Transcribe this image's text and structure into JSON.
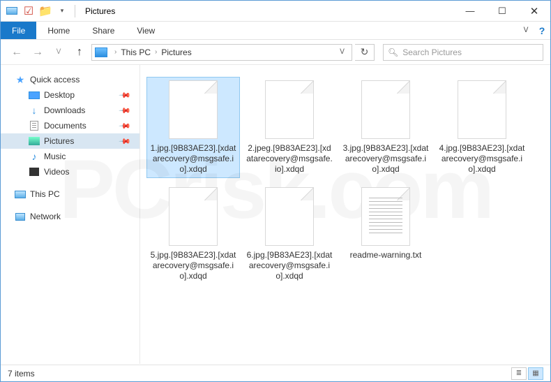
{
  "titlebar": {
    "app_title": "Pictures"
  },
  "window_controls": {
    "min": "—",
    "max": "☐",
    "close": "✕"
  },
  "ribbon": {
    "file_label": "File",
    "tabs": [
      "Home",
      "Share",
      "View"
    ],
    "chevron": "ᐯ",
    "help": "?"
  },
  "nav": {
    "back": "←",
    "forward": "→",
    "recent": "ᐯ",
    "up": "↑",
    "breadcrumb": [
      "This PC",
      "Pictures"
    ],
    "sep": "›",
    "drop": "ᐯ",
    "refresh": "↻",
    "search_placeholder": "Search Pictures",
    "search_icon": "🔍︎"
  },
  "sidebar": {
    "quick_access": "Quick access",
    "items": [
      {
        "label": "Desktop",
        "pinned": true
      },
      {
        "label": "Downloads",
        "pinned": true
      },
      {
        "label": "Documents",
        "pinned": true
      },
      {
        "label": "Pictures",
        "pinned": true,
        "selected": true
      },
      {
        "label": "Music",
        "pinned": false
      },
      {
        "label": "Videos",
        "pinned": false
      }
    ],
    "this_pc": "This PC",
    "network": "Network"
  },
  "files": [
    {
      "name": "1.jpg.[9B83AE23].[xdatarecovery@msgsafe.io].xdqd",
      "kind": "blank",
      "selected": true
    },
    {
      "name": "2.jpeg.[9B83AE23].[xdatarecovery@msgsafe.io].xdqd",
      "kind": "blank"
    },
    {
      "name": "3.jpg.[9B83AE23].[xdatarecovery@msgsafe.io].xdqd",
      "kind": "blank"
    },
    {
      "name": "4.jpg.[9B83AE23].[xdatarecovery@msgsafe.io].xdqd",
      "kind": "blank"
    },
    {
      "name": "5.jpg.[9B83AE23].[xdatarecovery@msgsafe.io].xdqd",
      "kind": "blank"
    },
    {
      "name": "6.jpg.[9B83AE23].[xdatarecovery@msgsafe.io].xdqd",
      "kind": "blank"
    },
    {
      "name": "readme-warning.txt",
      "kind": "txt"
    }
  ],
  "statusbar": {
    "count_text": "7 items"
  },
  "pin_glyph": "📌"
}
